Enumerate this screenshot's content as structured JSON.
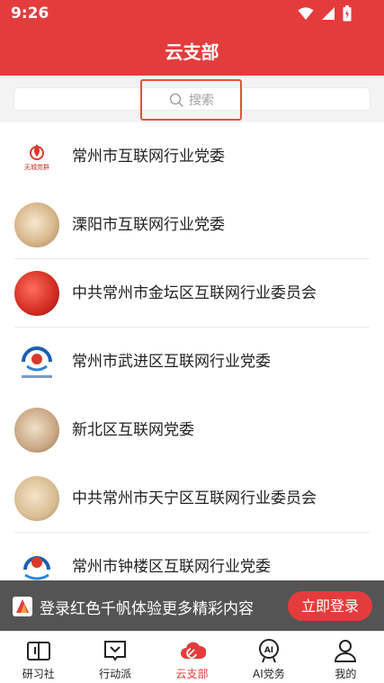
{
  "status": {
    "time": "9:26"
  },
  "header": {
    "title": "云支部"
  },
  "search": {
    "placeholder": "搜索"
  },
  "list": {
    "items": [
      {
        "name": "常州市互联网行业党委",
        "avatar_text": "无城党群"
      },
      {
        "name": "溧阳市互联网行业党委"
      },
      {
        "name": "中共常州市金坛区互联网行业委员会"
      },
      {
        "name": "常州市武进区互联网行业党委"
      },
      {
        "name": "新北区互联网党委"
      },
      {
        "name": "中共常州市天宁区互联网行业委员会"
      },
      {
        "name": "常州市钟楼区互联网行业党委"
      }
    ]
  },
  "login_banner": {
    "text": "登录红色千帆体验更多精彩内容",
    "button": "立即登录"
  },
  "tabbar": {
    "tabs": [
      {
        "label": "研习社",
        "icon": "book-icon"
      },
      {
        "label": "行动派",
        "icon": "flag-icon"
      },
      {
        "label": "云支部",
        "icon": "cloud-party-icon",
        "active": true
      },
      {
        "label": "AI党务",
        "icon": "ai-icon"
      },
      {
        "label": "我的",
        "icon": "user-icon"
      }
    ]
  },
  "colors": {
    "primary": "#e43c3c",
    "text": "#222222",
    "muted": "#a0a0a0"
  }
}
